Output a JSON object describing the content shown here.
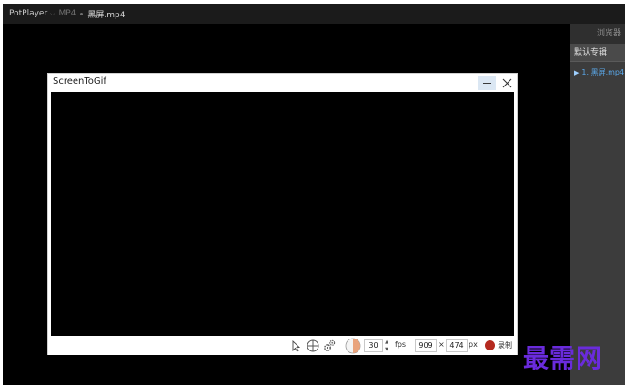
{
  "potplayer": {
    "app_name": "PotPlayer",
    "format": "MP4",
    "file_name": "黑屏.mp4",
    "sidebar": {
      "header": "浏览器",
      "tab": "默认专辑",
      "playlist": [
        "1. 黑屏.mp4"
      ]
    }
  },
  "screentogif": {
    "title": "ScreenToGif",
    "toolbar": {
      "fps_value": "30",
      "fps_unit": "fps",
      "width_value": "909",
      "times": "×",
      "height_value": "474",
      "size_unit": "px",
      "record_label": "录制"
    },
    "icons": [
      "cursor-icon",
      "crosshair-icon",
      "gear-icon",
      "frequency-icon",
      "record-icon"
    ]
  },
  "watermark": "最需网",
  "colors": {
    "accent_link": "#5aa7e8",
    "record": "#b52a1f",
    "watermark": "#6a2bdc"
  }
}
